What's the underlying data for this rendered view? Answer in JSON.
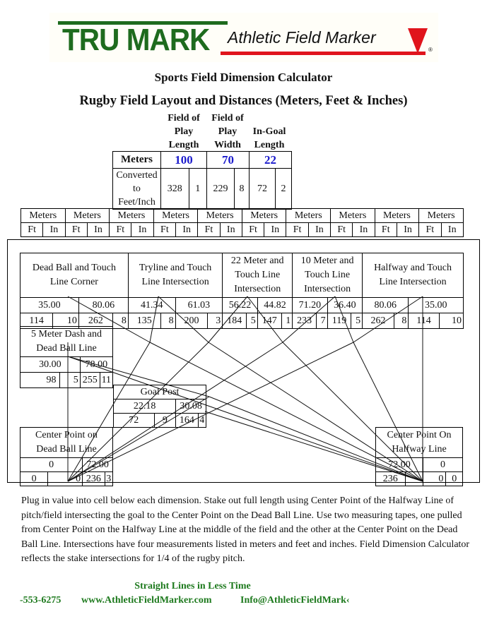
{
  "logo": {
    "brand": "TRU MARK",
    "tagline": "Athletic Field Marker",
    "registered": "®",
    "colors": {
      "green": "#1e6b1e",
      "red": "#e0141c"
    }
  },
  "titles": {
    "main": "Sports Field Dimension Calculator",
    "sub": "Rugby Field Layout and Distances (Meters, Feet & Inches)"
  },
  "inputs": {
    "headers": [
      "Field of Play Length",
      "Field of Play Width",
      "In-Goal Length"
    ],
    "header_lines": [
      [
        "Field of",
        "Play",
        "Length"
      ],
      [
        "Field of",
        "Play",
        "Width"
      ],
      [
        "",
        "In-Goal",
        "Length"
      ]
    ],
    "meters_label": "Meters",
    "converted_label": [
      "Converted",
      "to",
      "Feet/Inch"
    ],
    "meters": [
      "100",
      "70",
      "22"
    ],
    "feet_inches": [
      [
        "328",
        "1"
      ],
      [
        "229",
        "8"
      ],
      [
        "72",
        "2"
      ]
    ]
  },
  "unit_header": {
    "meters_label": "Meters",
    "ft_label": "Ft",
    "in_label": "In",
    "column_count": 10
  },
  "intersections": [
    {
      "name": "Dead Ball and Touch Line Corner",
      "lines": [
        "Dead Ball and Touch",
        "Line Corner"
      ],
      "m": [
        "35.00",
        "80.06"
      ],
      "ftin": [
        [
          "114",
          "10"
        ],
        [
          "262",
          "8"
        ]
      ]
    },
    {
      "name": "Tryline and Touch Line Intersection",
      "lines": [
        "Tryline and Touch",
        "Line Intersection"
      ],
      "m": [
        "41.34",
        "61.03"
      ],
      "ftin": [
        [
          "135",
          "8"
        ],
        [
          "200",
          "3"
        ]
      ]
    },
    {
      "name": "22 Meter and Touch Line Intersection",
      "lines": [
        "22 Meter and",
        "Touch Line",
        "Intersection"
      ],
      "m": [
        "56.22",
        "44.82"
      ],
      "ftin": [
        [
          "184",
          "5"
        ],
        [
          "147",
          "1"
        ]
      ]
    },
    {
      "name": "10 Meter and Touch Line Intersection",
      "lines": [
        "10 Meter and",
        "Touch Line",
        "Intersection"
      ],
      "m": [
        "71.20",
        "36.40"
      ],
      "ftin": [
        [
          "233",
          "7"
        ],
        [
          "119",
          "5"
        ]
      ]
    },
    {
      "name": "Halfway and Touch Line Intersection",
      "lines": [
        "Halfway and Touch",
        "Line Intersection"
      ],
      "m": [
        "80.06",
        "35.00"
      ],
      "ftin": [
        [
          "262",
          "8"
        ],
        [
          "114",
          "10"
        ]
      ]
    }
  ],
  "dash_box": {
    "lines": [
      "5 Meter Dash and",
      "Dead Ball Line"
    ],
    "m": [
      "30.00",
      "78.00"
    ],
    "ftin": [
      [
        "98",
        "5"
      ],
      [
        "255",
        "11"
      ]
    ]
  },
  "goal_post": {
    "title": "Goal Post",
    "m": [
      "22.18",
      "30.08"
    ],
    "ftin": [
      [
        "72",
        "9"
      ],
      [
        "164",
        "4"
      ]
    ]
  },
  "center_dead_ball": {
    "lines": [
      "Center Point on",
      "Dead Ball Line"
    ],
    "m": [
      "0",
      "72.00"
    ],
    "ftin": [
      [
        "0",
        "0"
      ],
      [
        "236",
        "3"
      ]
    ]
  },
  "center_halfway": {
    "lines": [
      "Center Point On",
      "Halfway Line"
    ],
    "m": [
      "72.00",
      "0"
    ],
    "ftin": [
      [
        "236",
        ""
      ],
      [
        "0",
        "0"
      ]
    ]
  },
  "instructions": "Plug in value into cell below each dimension. Stake out full length using Center Point of the Halfway Line of pitch/field intersecting the goal to the Center Point on the Dead Ball Line. Use two measuring tapes, one pulled from Center Point on the Halfway Line at the middle of the field and the other at the Center Point on the Dead Ball Line. Intersections have four measurements listed in meters and feet and inches. Field Dimension Calculator reflects the stake intersections for 1/4 of the rugby pitch.",
  "footer": {
    "slogan": "Straight Lines in Less Time",
    "phone": "-553-6275",
    "website": "www.AthleticFieldMarker.com",
    "email": "Info@AthleticFieldMark‹"
  }
}
